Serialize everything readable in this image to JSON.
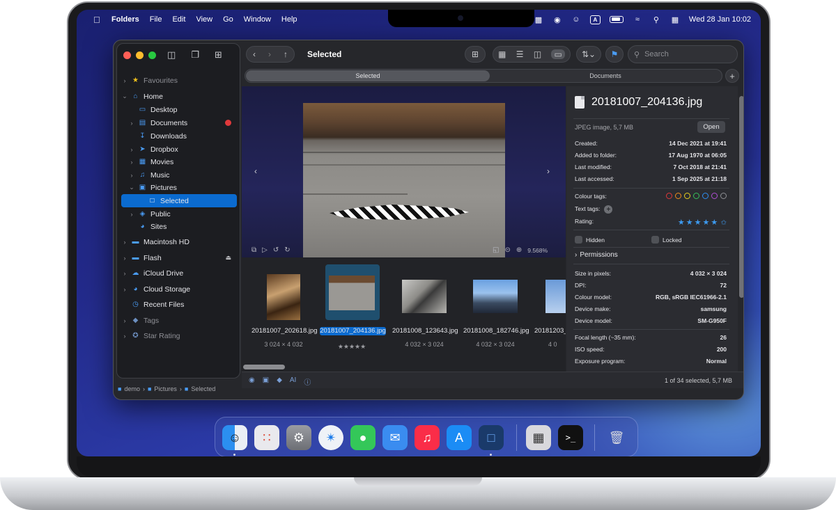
{
  "menubar": {
    "app_name": "Folders",
    "items": [
      "File",
      "Edit",
      "View",
      "Go",
      "Window",
      "Help"
    ],
    "input_badge": "A",
    "clock": "Wed 28 Jan  10:02"
  },
  "toolbar": {
    "title": "Selected",
    "search_placeholder": "Search"
  },
  "tabs": [
    {
      "label": "Selected",
      "active": true
    },
    {
      "label": "Documents",
      "active": false
    }
  ],
  "sidebar": {
    "items": [
      {
        "label": "Favourites",
        "icon": "star-icon"
      },
      {
        "label": "Home",
        "icon": "home-icon"
      },
      {
        "label": "Desktop",
        "icon": "desktop-icon"
      },
      {
        "label": "Documents",
        "icon": "document-icon",
        "tag_color": "#e0393b"
      },
      {
        "label": "Downloads",
        "icon": "download-icon"
      },
      {
        "label": "Dropbox",
        "icon": "dropbox-icon"
      },
      {
        "label": "Movies",
        "icon": "film-icon"
      },
      {
        "label": "Music",
        "icon": "music-icon"
      },
      {
        "label": "Pictures",
        "icon": "picture-icon"
      },
      {
        "label": "Selected",
        "icon": "folder-icon"
      },
      {
        "label": "Public",
        "icon": "public-icon"
      },
      {
        "label": "Sites",
        "icon": "globe-icon"
      },
      {
        "label": "Macintosh HD",
        "icon": "disk-icon"
      },
      {
        "label": "Flash",
        "icon": "disk-icon"
      },
      {
        "label": "iCloud Drive",
        "icon": "cloud-icon"
      },
      {
        "label": "Cloud Storage",
        "icon": "globe-icon"
      },
      {
        "label": "Recent Files",
        "icon": "clock-icon"
      },
      {
        "label": "Tags",
        "icon": "tag-icon"
      },
      {
        "label": "Star Rating",
        "icon": "star-circle-icon"
      }
    ]
  },
  "preview": {
    "zoom": "9.568%"
  },
  "thumbnails": [
    {
      "name": "20181007_202618.jpg",
      "dims": "3 024 × 4 032"
    },
    {
      "name": "20181007_204136.jpg",
      "rating": "★★★★★"
    },
    {
      "name": "20181008_123643.jpg",
      "dims": "4 032 × 3 024"
    },
    {
      "name": "20181008_182746.jpg",
      "dims": "4 032 × 3 024"
    },
    {
      "name": "20181203_",
      "dims": "4 0"
    }
  ],
  "inspector": {
    "file_name": "20181007_204136.jpg",
    "kind": "JPEG image, 5,7 MB",
    "open_label": "Open",
    "dates": [
      {
        "label": "Created:",
        "value": "14 Dec 2021 at 19:41"
      },
      {
        "label": "Added to folder:",
        "value": "17 Aug 1970 at 06:05"
      },
      {
        "label": "Last modified:",
        "value": "7 Oct 2018 at 21:41"
      },
      {
        "label": "Last accessed:",
        "value": "1 Sep 2025 at 21:18"
      }
    ],
    "colour_tags_label": "Colour tags:",
    "colour_tags": [
      "#e0393b",
      "#f08c1a",
      "#e8d21e",
      "#35c05a",
      "#2f8cf0",
      "#b04ed6",
      "#8e8f94"
    ],
    "text_tags_label": "Text tags:",
    "rating_label": "Rating:",
    "rating_stars": "★★★★★",
    "hidden_label": "Hidden",
    "locked_label": "Locked",
    "permissions_label": "Permissions",
    "exif": [
      {
        "label": "Size in pixels:",
        "value": "4 032 × 3 024"
      },
      {
        "label": "DPI:",
        "value": "72"
      },
      {
        "label": "Colour model:",
        "value": "RGB, sRGB IEC61966-2.1"
      },
      {
        "label": "Device make:",
        "value": "samsung"
      },
      {
        "label": "Device model:",
        "value": "SM-G950F"
      },
      {
        "label": "Focal length (~35 mm):",
        "value": "26"
      },
      {
        "label": "ISO speed:",
        "value": "200"
      },
      {
        "label": "Exposure program:",
        "value": "Normal"
      }
    ]
  },
  "status": {
    "count": "1 of 34 selected, 5,7 MB"
  },
  "path": [
    "demo",
    "Pictures",
    "Selected"
  ],
  "colors": {
    "accent": "#0b6bd0",
    "window_bg": "#26272b",
    "sidebar_bg": "#1c1d21"
  },
  "dock": {
    "apps": [
      "finder",
      "launchpad",
      "system-settings",
      "safari",
      "messages",
      "mail",
      "music",
      "app-store",
      "folders",
      "calculator",
      "terminal",
      "trash"
    ],
    "terminal_glyph": ">_"
  }
}
